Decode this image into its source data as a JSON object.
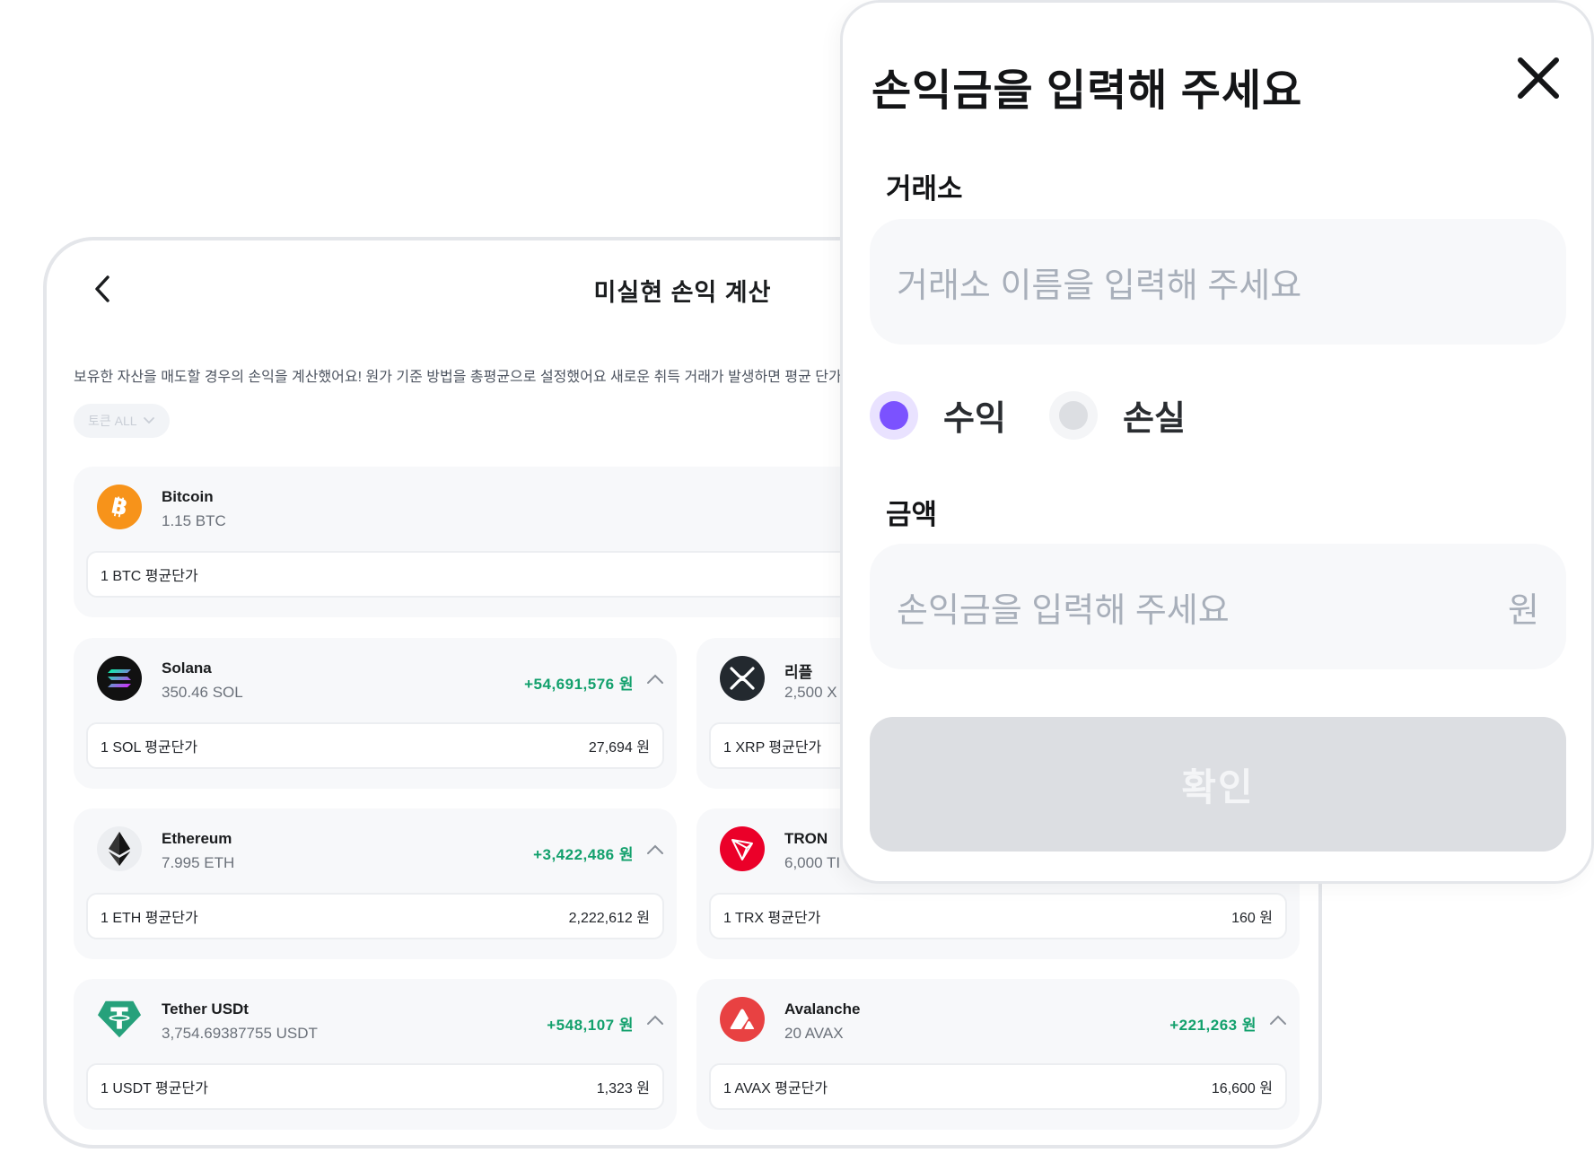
{
  "page": {
    "title": "미실현 손익 계산",
    "description": "보유한 자산을 매도할 경우의 손익을 계산했어요! 원가 기준 방법을 총평균으로 설정했어요 새로운 취득 거래가 발생하면 평균 단가(",
    "filter_chip": "토큰 ALL"
  },
  "coins": {
    "btc": {
      "name": "Bitcoin",
      "amount": "1.15 BTC",
      "avg_label": "1 BTC 평균단가"
    },
    "sol": {
      "name": "Solana",
      "amount": "350.46 SOL",
      "pnl": "+54,691,576 원",
      "avg_label": "1 SOL 평균단가",
      "avg_value": "27,694 원"
    },
    "xrp": {
      "name": "리플",
      "amount": "2,500 X",
      "avg_label": "1 XRP 평균단가"
    },
    "eth": {
      "name": "Ethereum",
      "amount": "7.995 ETH",
      "pnl": "+3,422,486 원",
      "avg_label": "1 ETH 평균단가",
      "avg_value": "2,222,612 원"
    },
    "trx": {
      "name": "TRON",
      "amount": "6,000 TI",
      "avg_label": "1 TRX 평균단가",
      "avg_value": "160 원"
    },
    "usdt": {
      "name": "Tether USDt",
      "amount": "3,754.69387755 USDT",
      "pnl": "+548,107 원",
      "avg_label": "1 USDT 평균단가",
      "avg_value": "1,323 원"
    },
    "avax": {
      "name": "Avalanche",
      "amount": "20 AVAX",
      "pnl": "+221,263 원",
      "avg_label": "1 AVAX 평균단가",
      "avg_value": "16,600 원"
    }
  },
  "modal": {
    "title": "손익금을 입력해 주세요",
    "exchange_label": "거래소",
    "exchange_placeholder": "거래소 이름을 입력해 주세요",
    "profit_label": "수익",
    "loss_label": "손실",
    "selected": "profit",
    "amount_label": "금액",
    "amount_placeholder": "손익금을 입력해 주세요",
    "amount_unit": "원",
    "confirm_label": "확인"
  },
  "colors": {
    "profit_green": "#12a06c",
    "radio_selected": "#7b52ff",
    "btc": "#f7931a",
    "tron": "#eb0029",
    "tether": "#26a17b",
    "avalanche": "#e84142"
  },
  "icons": {
    "back": "chevron-left-icon",
    "close": "close-icon",
    "expand": "chevron-up-icon",
    "filter": "chevron-down-icon"
  }
}
